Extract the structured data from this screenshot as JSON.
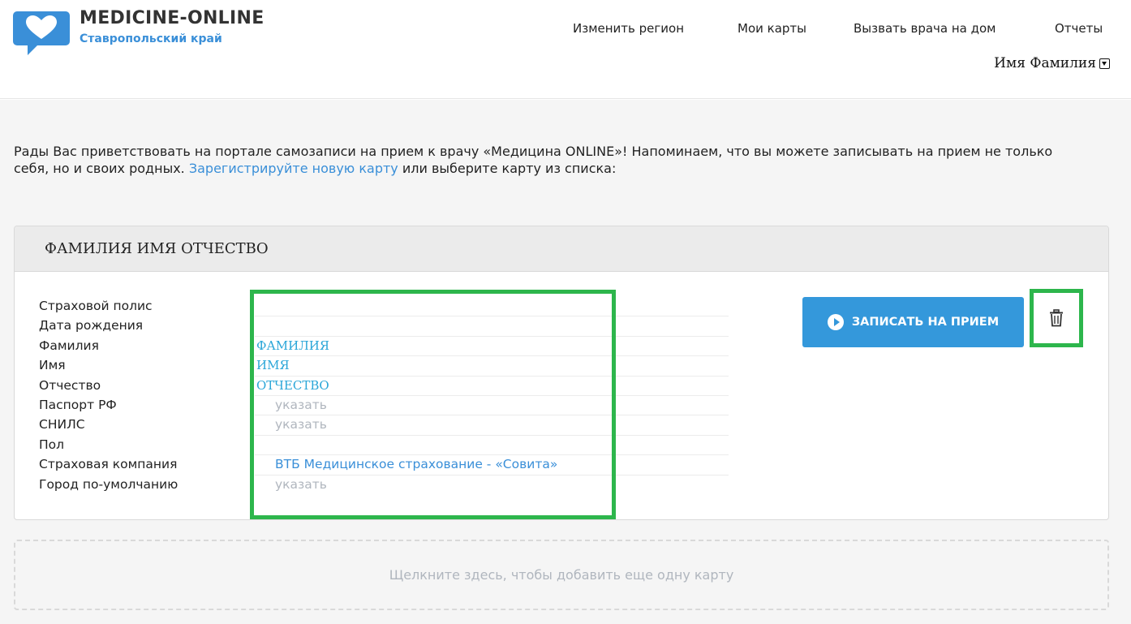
{
  "brand": {
    "name": "MEDICINE-ONLINE",
    "region": "Ставропольский край",
    "color": "#3a8fd8"
  },
  "nav": {
    "items": [
      {
        "label": "Изменить регион"
      },
      {
        "label": "Мои карты"
      },
      {
        "label": "Вызвать врача на дом"
      },
      {
        "label": "Отчеты"
      }
    ],
    "user": "Имя Фамилия"
  },
  "welcome": {
    "text1": "Рады Вас приветствовать на портале самозаписи на прием к врачу «Медицина ONLINE»! Напоминаем, что вы можете записывать на прием не только себя, но и своих родных. ",
    "link": "Зарегистрируйте новую карту",
    "text2": " или выберите карту из списка:"
  },
  "card": {
    "title": "ФАМИЛИЯ ИМЯ ОТЧЕСТВО",
    "fields": [
      {
        "label": "Страховой полис",
        "value": ""
      },
      {
        "label": "Дата рождения",
        "value": ""
      },
      {
        "label": "Фамилия",
        "value": "ФАМИЛИЯ"
      },
      {
        "label": "Имя",
        "value": "ИМЯ"
      },
      {
        "label": "Отчество",
        "value": "ОТЧЕСТВО"
      },
      {
        "label": "Паспорт РФ",
        "value": "указать"
      },
      {
        "label": "СНИЛС",
        "value": "указать"
      },
      {
        "label": "Пол",
        "value": ""
      },
      {
        "label": "Страховая компания",
        "value": "ВТБ Медицинское страхование - «Совита»"
      },
      {
        "label": "Город по-умолчанию",
        "value": "указать"
      }
    ],
    "book_button": "ЗАПИСАТЬ НА ПРИЕМ",
    "highlight_color": "#2db64c",
    "button_color": "#3498db"
  },
  "add_card": {
    "label": "Щелкните здесь, чтобы добавить еще одну карту"
  }
}
